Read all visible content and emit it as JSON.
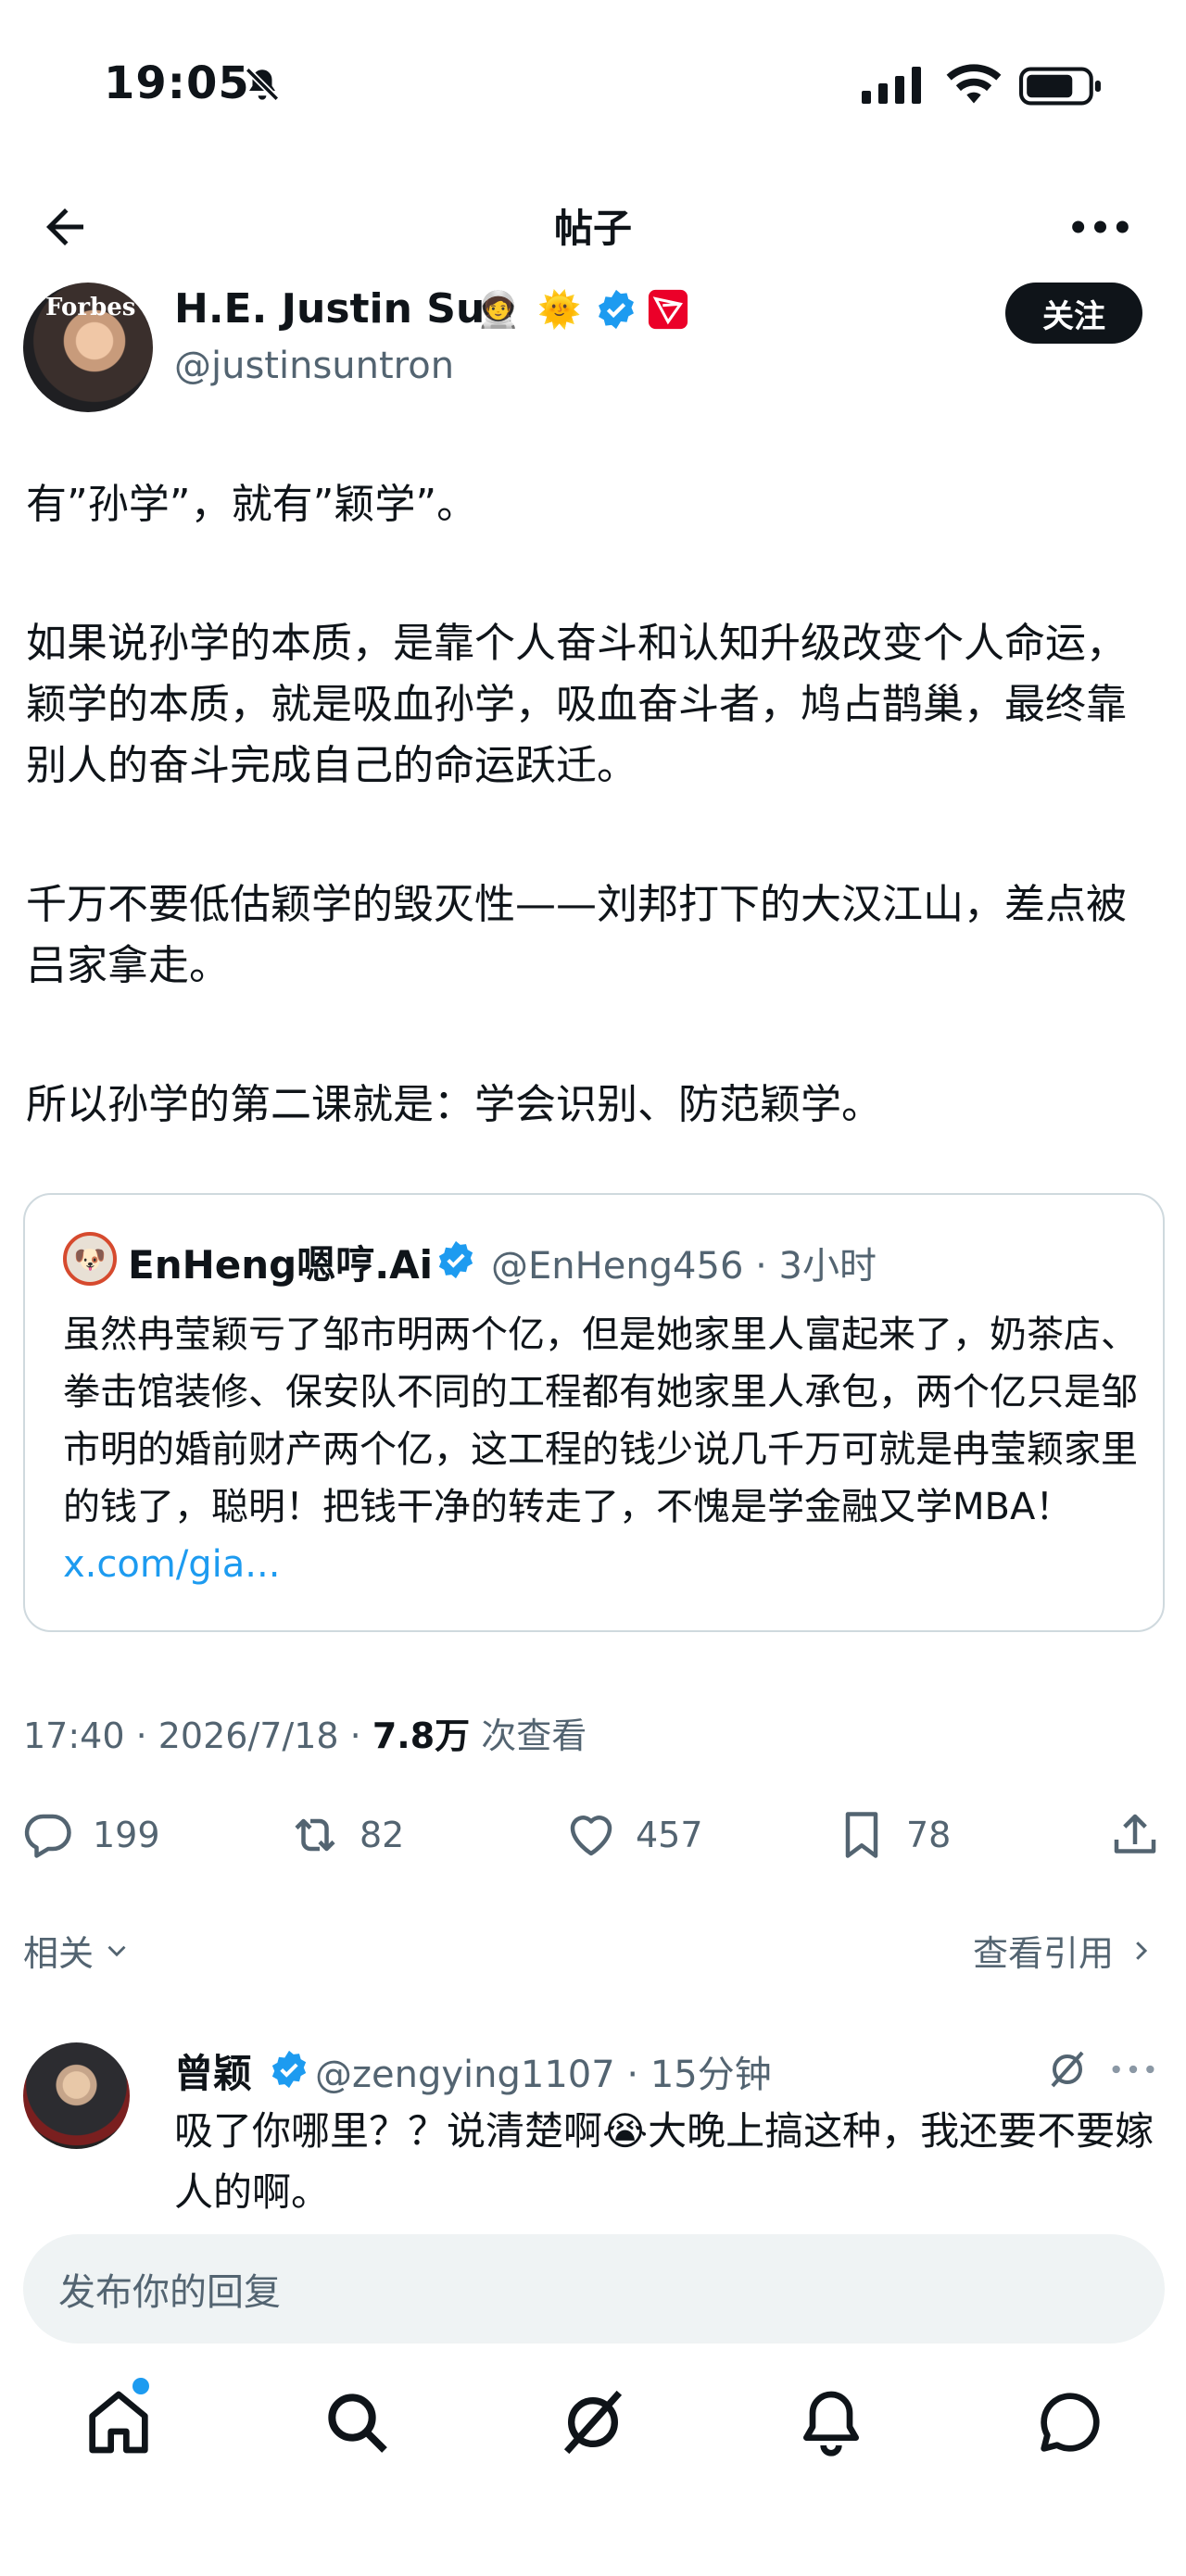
{
  "status_bar": {
    "time": "19:05"
  },
  "header": {
    "title": "帖子"
  },
  "post": {
    "author_name": "H.E. Justin Sun",
    "author_handle": "@justinsuntron",
    "avatar_text": "Forbes",
    "follow_label": "关注",
    "paragraphs": [
      "有”孙学”，就有”颖学”。",
      "如果说孙学的本质，是靠个人奋斗和认知升级改变个人命运，颖学的本质，就是吸血孙学，吸血奋斗者，鸠占鹊巢，最终靠别人的奋斗完成自己的命运跃迁。",
      "千万不要低估颖学的毁灭性——刘邦打下的大汉江山，差点被吕家拿走。",
      "所以孙学的第二课就是：学会识别、防范颖学。"
    ],
    "timestamp": "17:40 · 2026/7/18 · ",
    "views_count": "7.8万",
    "views_label": " 次查看"
  },
  "quote": {
    "name": "EnHeng嗯哼.Ai",
    "meta": "@EnHeng456 · 3小时",
    "text": "虽然冉莹颖亏了邹市明两个亿，但是她家里人富起来了，奶茶店、拳击馆装修、保安队不同的工程都有她家里人承包，两个亿只是邹市明的婚前财产两个亿，这工程的钱少说几千万可就是冉莹颖家里的钱了，聪明！把钱干净的转走了，不愧是学金融又学MBA！",
    "link": "x.com/gia..."
  },
  "actions": {
    "replies": "199",
    "reposts": "82",
    "likes": "457",
    "bookmarks": "78"
  },
  "related": {
    "label": "相关",
    "view_quotes": "查看引用"
  },
  "reply": {
    "name": "曾颖",
    "meta": "@zengying1107 · 15分钟",
    "text_part1": "吸了你哪里？？说清楚啊",
    "emoji": "😭",
    "text_part2": "大晚上搞这种，我还要不要嫁人的啊。"
  },
  "composer": {
    "placeholder": "发布你的回复"
  },
  "icons": {
    "back": "arrow-left-icon",
    "more": "more-horizontal-icon",
    "verified": "verified-badge-icon",
    "tron": "tron-logo-icon",
    "astronaut": "astronaut-emoji-icon",
    "sun": "sun-emoji-icon",
    "reply": "reply-icon",
    "repost": "repost-icon",
    "like": "heart-icon",
    "bookmark": "bookmark-icon",
    "share": "share-icon",
    "home": "home-icon",
    "search": "search-icon",
    "grok": "grok-icon",
    "notifications": "bell-icon",
    "messages": "message-icon"
  },
  "colors": {
    "accent": "#1d9bf0",
    "text": "#0f1419",
    "muted": "#536471",
    "tron": "#eb0029"
  }
}
